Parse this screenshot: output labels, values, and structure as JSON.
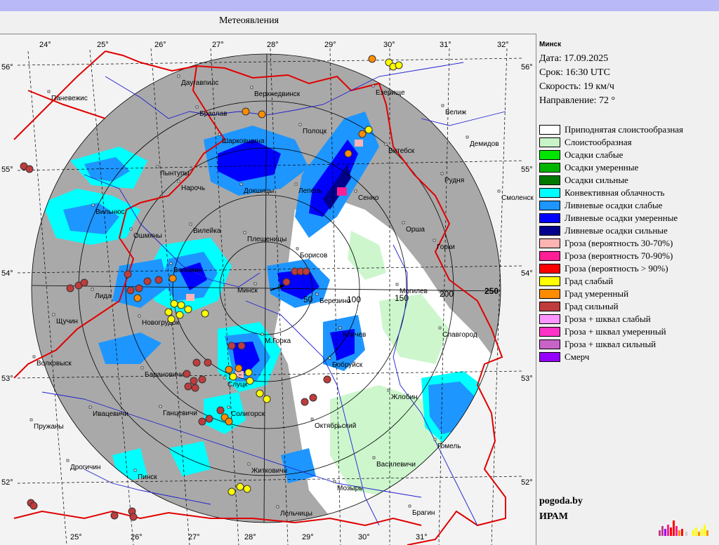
{
  "header": {
    "title": "Метеоявления"
  },
  "station": {
    "city": "Минск",
    "date": "Дата: 17.09.2025",
    "time": "Срок: 16:30 UTC",
    "speed": "Скорость: 19  км/ч",
    "direction": "Направление:  72 °"
  },
  "legend": [
    {
      "label": "Приподнятая слоистообразная",
      "color": "#ffffff"
    },
    {
      "label": "Слоистообразная",
      "color": "#c8f5c8"
    },
    {
      "label": "Осадки слабые",
      "color": "#00e600"
    },
    {
      "label": "Осадки умеренные",
      "color": "#00b400"
    },
    {
      "label": "Осадки сильные",
      "color": "#007800"
    },
    {
      "label": "Конвективная облачность",
      "color": "#00ffff"
    },
    {
      "label": "Ливневые осадки слабые",
      "color": "#1e96ff"
    },
    {
      "label": "Ливневые осадки умеренные",
      "color": "#0000ff"
    },
    {
      "label": "Ливневые осадки сильные",
      "color": "#00008c"
    },
    {
      "label": "Гроза (вероятность 30-70%)",
      "color": "#ffb4b4"
    },
    {
      "label": "Гроза (вероятность 70-90%)",
      "color": "#ff1e96"
    },
    {
      "label": "Гроза (вероятность > 90%)",
      "color": "#ff0000"
    },
    {
      "label": "Град слабый",
      "color": "#ffff00"
    },
    {
      "label": "Град умеренный",
      "color": "#ff8c00"
    },
    {
      "label": "Град сильный",
      "color": "#c03c3c"
    },
    {
      "label": "Гроза + шквал слабый",
      "color": "#ff96ff"
    },
    {
      "label": "Гроза + шквал умеренный",
      "color": "#ff32c8"
    },
    {
      "label": "Гроза + шквал сильный",
      "color": "#c864c8"
    },
    {
      "label": "Смерч",
      "color": "#9600ff"
    }
  ],
  "brand": {
    "site": "pogoda.by",
    "org": "ИРАМ"
  },
  "map": {
    "lon_top": [
      "24°",
      "25°",
      "26°",
      "27°",
      "28°",
      "29°",
      "30°",
      "31°",
      "32°"
    ],
    "lon_bottom": [
      "25°",
      "26°",
      "27°",
      "28°",
      "29°",
      "30°",
      "31°"
    ],
    "lat_left": [
      "56°",
      "55°",
      "54°",
      "53°",
      "52°"
    ],
    "lat_right": [
      "56°",
      "55°",
      "54°",
      "53°",
      "52°"
    ],
    "range_labels": [
      "50",
      "100",
      "150",
      "200",
      "250"
    ],
    "cities": [
      "Даугавпилс",
      "Верхнедвинск",
      "Браслав",
      "Полоцк",
      "Шарковщина",
      "Витебск",
      "Лынтупы",
      "Нарочь",
      "Докшицы",
      "Лепель",
      "Сенно",
      "Вильнюс",
      "Ошмяны",
      "Вилейка",
      "Плещеницы",
      "Борисов",
      "Орша",
      "Горки",
      "Лида",
      "Воложин",
      "Минск",
      "Березино",
      "Могилев",
      "Щучин",
      "Новогрудок",
      "М.Горка",
      "Кличев",
      "Бобруйск",
      "Волковыск",
      "Барановичи",
      "Слуцк",
      "Ивацевичи",
      "Ганцевичи",
      "Солигорск",
      "Жлобин",
      "Пружаны",
      "Октябрьский",
      "Гомель",
      "Дрогичин",
      "Пинск",
      "Житковичи",
      "Василевичи",
      "Мозырь",
      "Лельчицы",
      "Брагин",
      "Паневежис",
      "Езерище",
      "Велиж",
      "Демидов",
      "Рудня",
      "Смоленск",
      "Славгород"
    ]
  }
}
